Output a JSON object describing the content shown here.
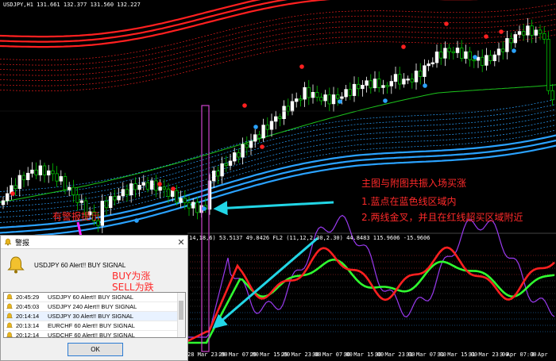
{
  "symbol_line": "USDJPY,H1  131.661 132.377 131.560 132.227",
  "sub_indicator_line": "14,18,6) 53.5137 49.8426  FL2 (11,12,2.30,2.30) 44.8483 115.9606 -15.9606",
  "x_labels": [
    "28 Mar 23:00",
    "29 Mar 07:00",
    "29 Mar 15:00",
    "29 Mar 23:00",
    "30 Mar 07:00",
    "30 Mar 15:00",
    "30 Mar 23:00",
    "31 Mar 07:00",
    "31 Mar 15:00",
    "31 Mar 23:00",
    "3 Apr 07:00",
    "3 Apr"
  ],
  "annotations": {
    "main_title": "主图与附图共振入场买涨",
    "point1": "1.蓝点在蓝色线区域内",
    "point2": "2.两线金叉，并且在红线超买区域附近",
    "alert_hint": "有警报提示",
    "buy_label": "BUY为涨",
    "sell_label": "SELL为跌"
  },
  "alert_dialog": {
    "title": "警报",
    "message": "USDJPY 60 Alert!! BUY SIGNAL",
    "rows": [
      {
        "time": "20:45:29",
        "text": "USDJPY 60 Alert!! BUY SIGNAL"
      },
      {
        "time": "20:45:03",
        "text": "USDJPY 240 Alert!! BUY SIGNAL"
      },
      {
        "time": "20:14:14",
        "text": "USDJPY 30 Alert!! BUY SIGNAL"
      },
      {
        "time": "20:13:14",
        "text": "EURCHF 60 Alert!! BUY SIGNAL"
      },
      {
        "time": "20:12:14",
        "text": "USDCHF 60 Alert!! BUY SIGNAL"
      }
    ],
    "ok_label": "OK",
    "close_glyph": "✕"
  },
  "colors": {
    "background": "#000000",
    "bull": "#ffffff",
    "bear": "#00c000",
    "upper_band": "#ff2020",
    "lower_band": "#2aa2ff",
    "ma": "#1cc41c",
    "highlight_box": "#cc44cc",
    "arrow": "#22d6e6",
    "signal_red": "#ff2020",
    "signal_green": "#30ff30",
    "purple_line": "#9a3af0"
  }
}
